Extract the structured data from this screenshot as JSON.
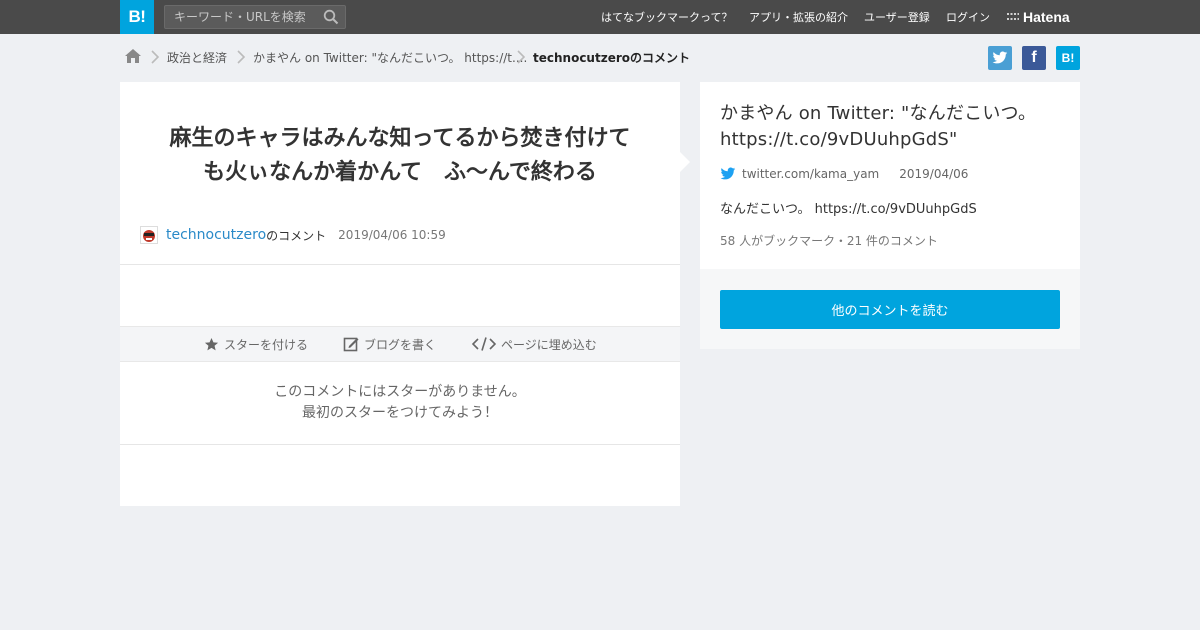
{
  "header": {
    "logo_text": "B!",
    "search_placeholder": "キーワード・URLを検索",
    "nav": [
      "はてなブックマークって？",
      "アプリ・拡張の紹介",
      "ユーザー登録",
      "ログイン"
    ],
    "brand": "Hatena"
  },
  "breadcrumb": {
    "items": [
      "政治と経済",
      "かまやん on Twitter: \"なんだこいつ。 https://t...."
    ],
    "current": "technocutzeroのコメント"
  },
  "share": {
    "twitter_icon": "twitter-icon",
    "facebook_label": "f",
    "hatena_label": "B!"
  },
  "comment": {
    "text_line1": "麻生のキャラはみんな知ってるから焚き付けて",
    "text_line2": "も火ぃなんか着かんて　ふ～んで終わる",
    "user": "technocutzero",
    "user_suffix": "のコメント",
    "date": "2019/04/06 10:59"
  },
  "actions": {
    "star": "スターを付ける",
    "blog": "ブログを書く",
    "embed": "ページに埋め込む"
  },
  "no_star": {
    "line1": "このコメントにはスターがありません。",
    "line2": "最初のスターをつけてみよう！"
  },
  "entry": {
    "title": "かまやん on Twitter: \"なんだこいつ。 https://t.co/9vDUuhpGdS\"",
    "source": "twitter.com/kama_yam",
    "date": "2019/04/06",
    "description": "なんだこいつ。 https://t.co/9vDUuhpGdS",
    "stats": "58 人がブックマーク・21 件のコメント",
    "read_button": "他のコメントを読む"
  },
  "colors": {
    "brand_blue": "#00a4de",
    "header_bg": "#4a4a4a",
    "twitter": "#1da1f2",
    "facebook": "#3b5998",
    "link": "#2a8ac8"
  }
}
